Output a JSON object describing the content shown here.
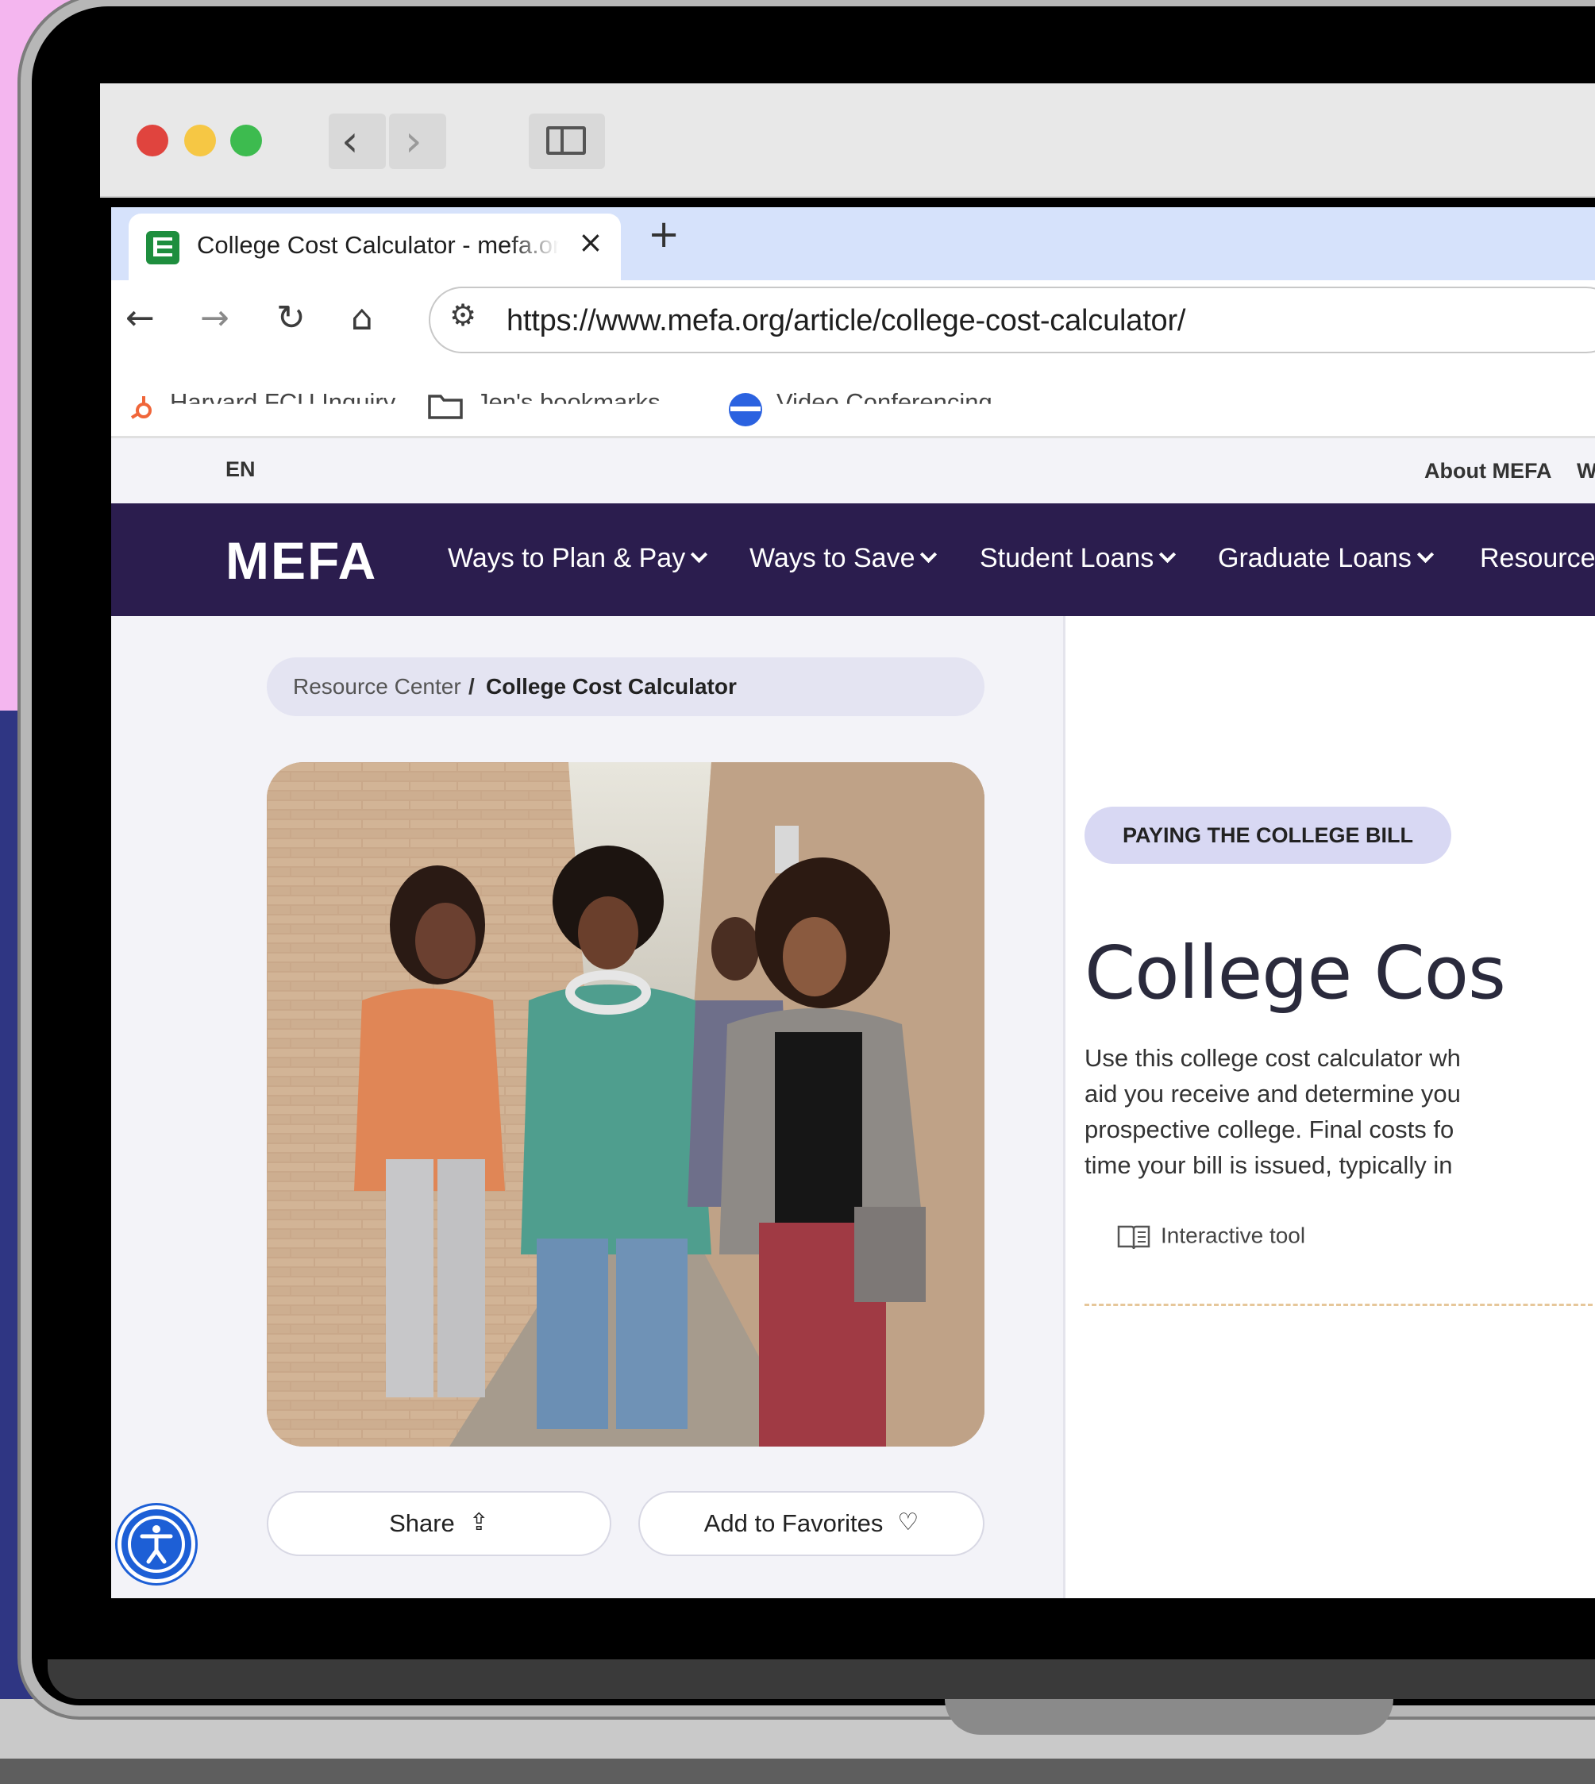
{
  "browser": {
    "tab_title": "College Cost Calculator - mefa.org",
    "tab_close": "×",
    "new_tab": "+",
    "url": "https://www.mefa.org/article/college-cost-calculator/",
    "bookmarks": [
      "Harvard FCU Inquiry",
      "Jen's bookmarks",
      "Video Conferencing..."
    ]
  },
  "site": {
    "lang": "EN",
    "util_links": [
      "About MEFA",
      "W"
    ],
    "logo": "MEFA",
    "nav": [
      {
        "label": "Ways to Plan & Pay"
      },
      {
        "label": "Ways to Save"
      },
      {
        "label": "Student Loans"
      },
      {
        "label": "Graduate Loans"
      },
      {
        "label": "Resource"
      }
    ]
  },
  "breadcrumb": {
    "parent": "Resource Center",
    "separator": "/",
    "current": "College Cost Calculator"
  },
  "hero_alt": "",
  "actions": {
    "share": "Share",
    "favorite": "Add to Favorites"
  },
  "article": {
    "category": "PAYING THE COLLEGE BILL",
    "title": "College Cos",
    "description_lines": [
      "Use this college cost calculator wh",
      "aid you receive and determine you",
      "prospective college. Final costs fo",
      "time your bill is issued, typically in"
    ],
    "type_label": "Interactive tool"
  },
  "colors": {
    "nav_bg": "#2b1d4e",
    "pill_bg": "#d8d8f3",
    "accessibility": "#1d5fd6"
  },
  "icons": [
    "back-arrow-icon",
    "forward-arrow-icon",
    "reload-icon",
    "home-icon",
    "tune-icon",
    "share-icon",
    "heart-icon",
    "book-icon",
    "accessibility-icon"
  ]
}
